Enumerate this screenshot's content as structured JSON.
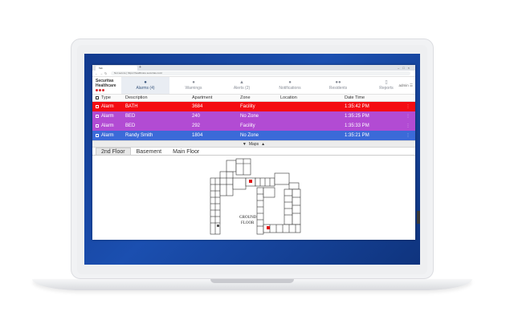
{
  "browser": {
    "tab_title": "Tab",
    "url": "Not secure | https://healthcare.securitas.com/"
  },
  "brand": {
    "line1": "Securitas",
    "line2": "Healthcare"
  },
  "nav": {
    "tabs": [
      {
        "label": "Alarms (4)",
        "icon": "bell-icon"
      },
      {
        "label": "Warnings",
        "icon": "warning-circle-icon"
      },
      {
        "label": "Alerts (2)",
        "icon": "alert-triangle-icon"
      },
      {
        "label": "Notifications",
        "icon": "info-icon"
      },
      {
        "label": "Residents",
        "icon": "people-icon"
      },
      {
        "label": "Reports",
        "icon": "document-icon"
      }
    ],
    "user": "admin"
  },
  "table": {
    "headers": {
      "type": "Type",
      "description": "Description",
      "apartment": "Apartment",
      "zone": "Zone",
      "location": "Location",
      "datetime": "Date Time"
    },
    "rows": [
      {
        "type": "Alarm",
        "description": "BATH",
        "apartment": "3684",
        "zone": "Facility",
        "location": "",
        "time": "1:35:42 PM",
        "color": "#f40c12"
      },
      {
        "type": "Alarm",
        "description": "BED",
        "apartment": "240",
        "zone": "No Zone",
        "location": "",
        "time": "1:35:25 PM",
        "color": "#b24bd3"
      },
      {
        "type": "Alarm",
        "description": "BED",
        "apartment": "292",
        "zone": "Facility",
        "location": "",
        "time": "1:35:33 PM",
        "color": "#b24bd3"
      },
      {
        "type": "Alarm",
        "description": "Randy Smith",
        "apartment": "1804",
        "zone": "No Zone",
        "location": "",
        "time": "1:35:21 PM",
        "color": "#3b6ad8"
      }
    ]
  },
  "maps": {
    "toggle_label": "Maps",
    "floors": [
      "2nd Floor",
      "Basement",
      "Main Floor"
    ],
    "selected_floor": "2nd Floor",
    "floor_label_line1": "GROUND",
    "floor_label_line2": "FLOOR"
  }
}
